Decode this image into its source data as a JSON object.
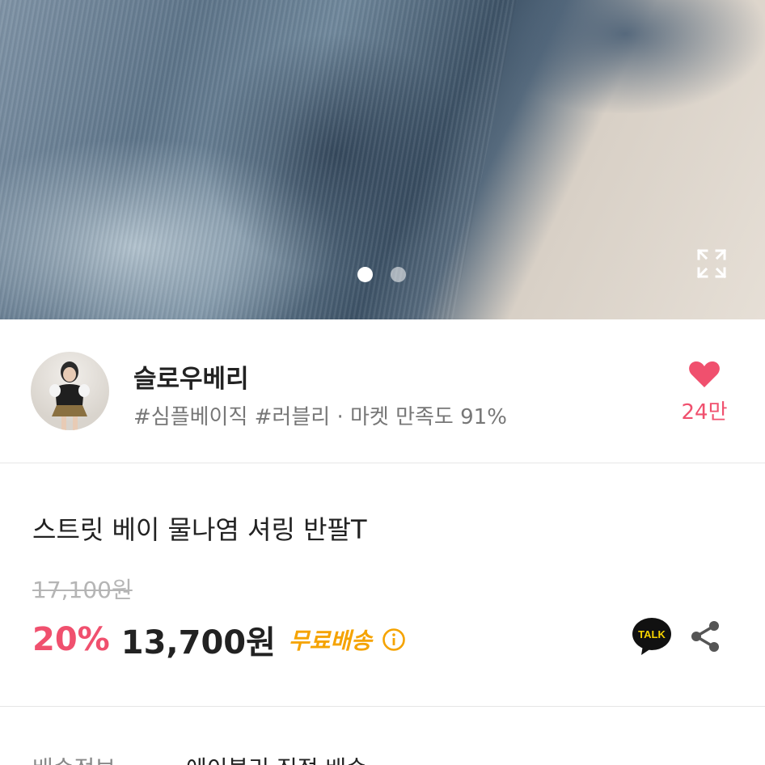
{
  "hero": {
    "image_name": "product-photo",
    "slides_total": 2,
    "active_slide": 1
  },
  "seller": {
    "name": "슬로우베리",
    "tags": "#심플베이직 #러블리 · 마켓 만족도 91%",
    "like_count": "24만",
    "colors": {
      "like": "#f0506e"
    }
  },
  "product": {
    "title": "스트릿 베이 물나염 셔링 반팔T",
    "original_price": "17,100원",
    "discount_rate": "20%",
    "price": "13,700원",
    "shipping_badge": "무료배송",
    "talk_label": "TALK",
    "colors": {
      "discount": "#f0506e",
      "shipping": "#f5a300"
    }
  },
  "delivery": {
    "label": "배송정보",
    "value": "에이블리 직접 배송"
  }
}
